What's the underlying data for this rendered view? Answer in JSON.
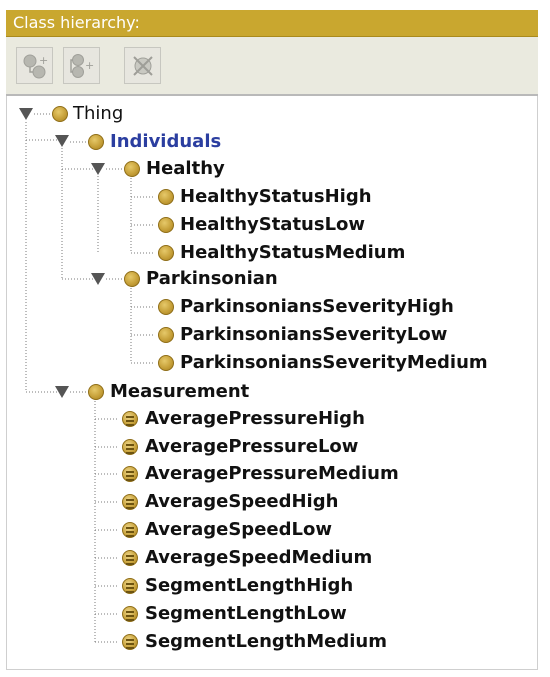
{
  "panel": {
    "title": "Class hierarchy:"
  },
  "toolbar": {
    "buttons": [
      {
        "icon": "add-subclass-icon"
      },
      {
        "icon": "add-sibling-class-icon"
      },
      {
        "icon": "delete-class-icon"
      }
    ]
  },
  "tree": {
    "root": "Thing",
    "individuals": "Individuals",
    "healthy": "Healthy",
    "healthy_items": [
      "HealthyStatusHigh",
      "HealthyStatusLow",
      "HealthyStatusMedium"
    ],
    "parkinsonian": "Parkinsonian",
    "parkinsonian_items": [
      "ParkinsoniansSeverityHigh",
      "ParkinsoniansSeverityLow",
      "ParkinsoniansSeverityMedium"
    ],
    "measurement": "Measurement",
    "measurement_items": [
      "AveragePressureHigh",
      "AveragePressureLow",
      "AveragePressureMedium",
      "AverageSpeedHigh",
      "AverageSpeedLow",
      "AverageSpeedMedium",
      "SegmentLengthHigh",
      "SegmentLengthLow",
      "SegmentLengthMedium"
    ]
  },
  "colors": {
    "titlebar": "#c9a72f",
    "toolbar": "#eaeadf",
    "class_dot": "#c7a13a",
    "individuals_label": "#2b3ea0"
  }
}
